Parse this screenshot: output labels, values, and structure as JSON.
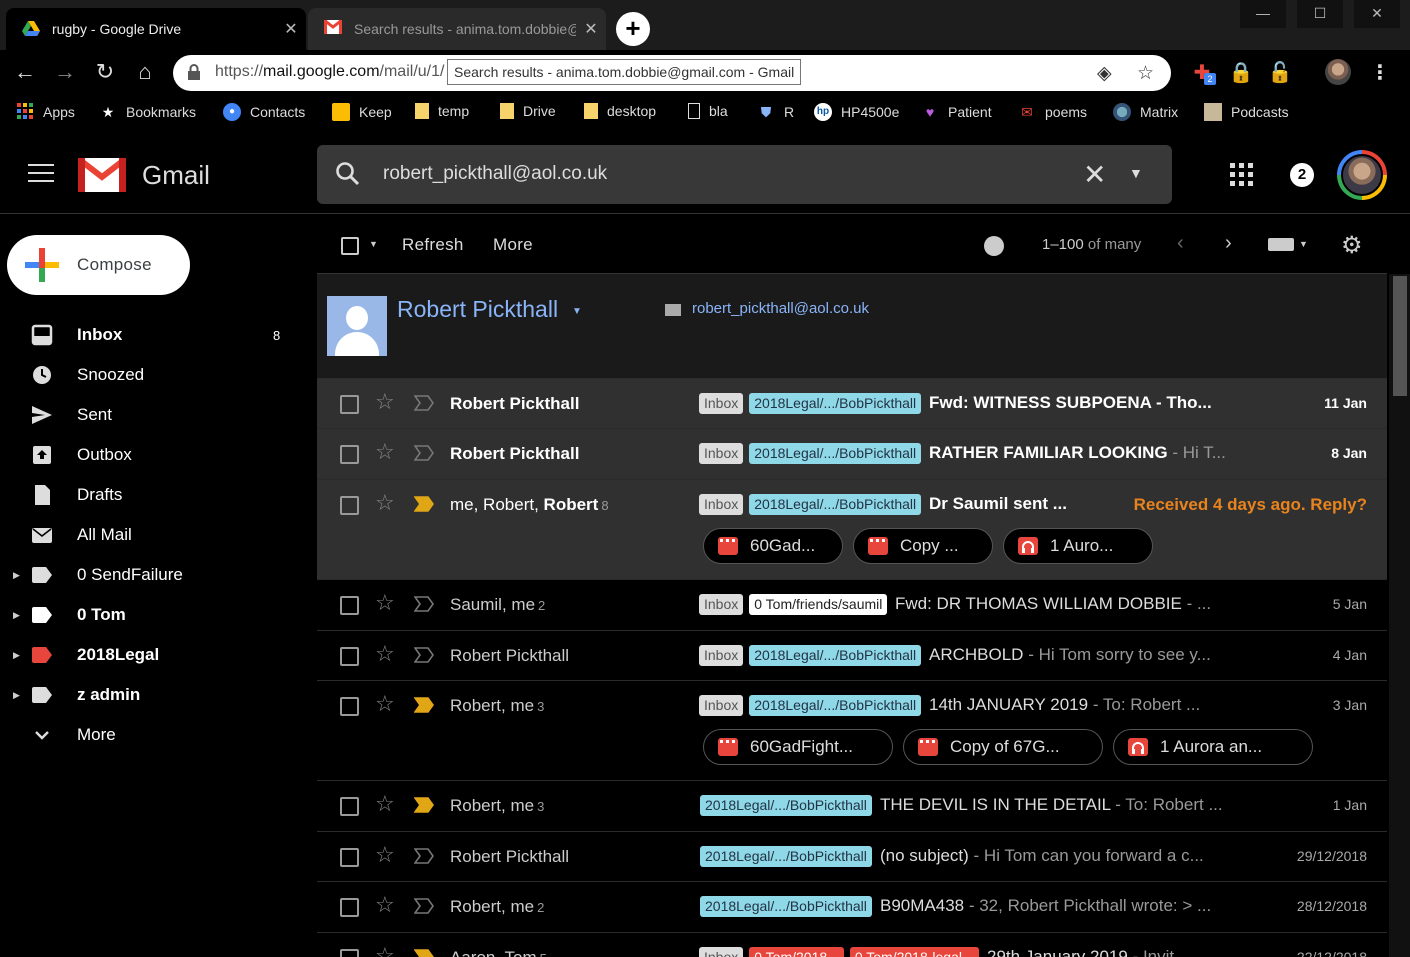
{
  "browser": {
    "tabs": [
      {
        "title": "rugby - Google Drive",
        "active": true
      },
      {
        "title": "Search results - anima.tom.dobbie@gmail.com - Gmail",
        "active": false
      }
    ],
    "url_scheme": "https://",
    "url_host": "mail.google.com",
    "url_path": "/mail/u/1/",
    "tooltip": "Search results - anima.tom.dobbie@gmail.com - Gmail",
    "extension_badge": "2",
    "bookmarks": [
      {
        "label": "Apps",
        "icon": "apps-icon"
      },
      {
        "label": "Bookmarks",
        "icon": "star-icon"
      },
      {
        "label": "Contacts",
        "icon": "contacts-icon"
      },
      {
        "label": "Keep",
        "icon": "keep-icon"
      },
      {
        "label": "temp",
        "icon": "folder-icon"
      },
      {
        "label": "Drive",
        "icon": "folder-icon"
      },
      {
        "label": "desktop",
        "icon": "folder-icon"
      },
      {
        "label": "bla",
        "icon": "page-icon"
      },
      {
        "label": "R",
        "icon": "shield-icon"
      },
      {
        "label": "HP4500e",
        "icon": "hp-icon"
      },
      {
        "label": "Patient",
        "icon": "heart-icon"
      },
      {
        "label": "poems",
        "icon": "gmail-icon"
      },
      {
        "label": "Matrix",
        "icon": "globe-icon"
      },
      {
        "label": "Podcasts",
        "icon": "podcast-icon"
      }
    ]
  },
  "gmail": {
    "brand": "Gmail",
    "search_query": "robert_pickthall@aol.co.uk",
    "notifications": "2",
    "compose_label": "Compose",
    "nav": [
      {
        "label": "Inbox",
        "count": "8",
        "icon": "inbox-icon",
        "bold": true,
        "arrow": false
      },
      {
        "label": "Snoozed",
        "count": "",
        "icon": "clock-icon",
        "bold": false,
        "arrow": false
      },
      {
        "label": "Sent",
        "count": "",
        "icon": "send-icon",
        "bold": false,
        "arrow": false
      },
      {
        "label": "Outbox",
        "count": "",
        "icon": "outbox-icon",
        "bold": false,
        "arrow": false
      },
      {
        "label": "Drafts",
        "count": "",
        "icon": "draft-icon",
        "bold": false,
        "arrow": false
      },
      {
        "label": "All Mail",
        "count": "",
        "icon": "mail-icon",
        "bold": false,
        "arrow": false
      },
      {
        "label": "0 SendFailure",
        "count": "",
        "icon": "label-icon",
        "bold": false,
        "arrow": true,
        "color": "#dddddd"
      },
      {
        "label": "0 Tom",
        "count": "",
        "icon": "label-icon",
        "bold": true,
        "arrow": true,
        "color": "#ffffff"
      },
      {
        "label": "2018Legal",
        "count": "",
        "icon": "label-icon",
        "bold": true,
        "arrow": true,
        "color": "#e8453c"
      },
      {
        "label": "z admin",
        "count": "",
        "icon": "label-icon",
        "bold": true,
        "arrow": true,
        "color": "#dddddd"
      },
      {
        "label": "More",
        "count": "",
        "icon": "chevron-down-icon",
        "bold": false,
        "arrow": false
      }
    ],
    "toolbar": {
      "refresh": "Refresh",
      "more": "More",
      "range": "1–100",
      "range_suffix": "of many"
    },
    "contact": {
      "name": "Robert Pickthall",
      "email": "robert_pickthall@aol.co.uk"
    },
    "messages": [
      {
        "sender": "Robert Pickthall",
        "sender_bold": "Robert Pickthall",
        "count": "",
        "unread": true,
        "important": false,
        "labels": [
          {
            "text": "Inbox",
            "kind": "inbox"
          },
          {
            "text": "2018Legal/.../BobPickthall",
            "kind": "legal"
          }
        ],
        "subject": "Fwd: WITNESS SUBPOENA - Tho...",
        "snippet": "",
        "date": "11 Jan",
        "nudge": "",
        "attachments": []
      },
      {
        "sender": "Robert Pickthall",
        "sender_bold": "Robert Pickthall",
        "count": "",
        "unread": true,
        "important": false,
        "labels": [
          {
            "text": "Inbox",
            "kind": "inbox"
          },
          {
            "text": "2018Legal/.../BobPickthall",
            "kind": "legal"
          }
        ],
        "subject": "RATHER FAMILIAR LOOKING",
        "snippet": " - Hi T...",
        "date": "8 Jan",
        "nudge": "",
        "attachments": []
      },
      {
        "sender": "me, Robert, ",
        "sender_bold": "Robert",
        "count": "8",
        "unread": true,
        "important": true,
        "labels": [
          {
            "text": "Inbox",
            "kind": "inbox"
          },
          {
            "text": "2018Legal/.../BobPickthall",
            "kind": "legal"
          }
        ],
        "subject": "Dr Saumil sent ...",
        "snippet": "",
        "date": "",
        "nudge": "Received 4 days ago. Reply?",
        "attachments": [
          {
            "name": "60Gad...",
            "kind": "video"
          },
          {
            "name": "Copy ...",
            "kind": "video"
          },
          {
            "name": "1 Auro...",
            "kind": "audio"
          }
        ]
      },
      {
        "sender": "Saumil, me",
        "sender_bold": "",
        "count": "2",
        "unread": false,
        "important": false,
        "labels": [
          {
            "text": "Inbox",
            "kind": "inbox"
          },
          {
            "text": "0 Tom/friends/saumil",
            "kind": "tom"
          }
        ],
        "subject": "Fwd: DR THOMAS WILLIAM DOBBIE",
        "snippet": " - ...",
        "date": "5 Jan",
        "nudge": "",
        "attachments": []
      },
      {
        "sender": "Robert Pickthall",
        "sender_bold": "",
        "count": "",
        "unread": false,
        "important": false,
        "labels": [
          {
            "text": "Inbox",
            "kind": "inbox"
          },
          {
            "text": "2018Legal/.../BobPickthall",
            "kind": "legal"
          }
        ],
        "subject": "ARCHBOLD",
        "snippet": " - Hi Tom sorry to see y...",
        "date": "4 Jan",
        "nudge": "",
        "attachments": []
      },
      {
        "sender": "Robert, me",
        "sender_bold": "",
        "count": "3",
        "unread": false,
        "important": true,
        "labels": [
          {
            "text": "Inbox",
            "kind": "inbox"
          },
          {
            "text": "2018Legal/.../BobPickthall",
            "kind": "legal"
          }
        ],
        "subject": "14th JANUARY 2019",
        "snippet": " - To: Robert ...",
        "date": "3 Jan",
        "nudge": "",
        "attachments": [
          {
            "name": "60GadFight...",
            "kind": "video"
          },
          {
            "name": "Copy of 67G...",
            "kind": "video"
          },
          {
            "name": "1 Aurora an...",
            "kind": "audio"
          }
        ]
      },
      {
        "sender": "Robert, me",
        "sender_bold": "",
        "count": "3",
        "unread": false,
        "important": true,
        "labels": [
          {
            "text": "2018Legal/.../BobPickthall",
            "kind": "legal"
          }
        ],
        "subject": "THE DEVIL IS IN THE DETAIL",
        "snippet": " - To: Robert ...",
        "date": "1 Jan",
        "nudge": "",
        "attachments": []
      },
      {
        "sender": "Robert Pickthall",
        "sender_bold": "",
        "count": "",
        "unread": false,
        "important": false,
        "labels": [
          {
            "text": "2018Legal/.../BobPickthall",
            "kind": "legal"
          }
        ],
        "subject": "(no subject)",
        "snippet": " - Hi Tom can you forward a c...",
        "date": "29/12/2018",
        "nudge": "",
        "attachments": []
      },
      {
        "sender": "Robert, me",
        "sender_bold": "",
        "count": "2",
        "unread": false,
        "important": false,
        "labels": [
          {
            "text": "2018Legal/.../BobPickthall",
            "kind": "legal"
          }
        ],
        "subject": "B90MA438",
        "snippet": " - 32, Robert Pickthall wrote: > ...",
        "date": "28/12/2018",
        "nudge": "",
        "attachments": []
      },
      {
        "sender": "Aaron, Tom",
        "sender_bold": "",
        "count": "5",
        "unread": false,
        "important": true,
        "labels": [
          {
            "text": "Inbox",
            "kind": "inbox"
          },
          {
            "text": "0 Tom/2018...",
            "kind": "red"
          },
          {
            "text": "0 Tom/2018-legal...",
            "kind": "red"
          }
        ],
        "subject": "29th January 2019",
        "snippet": " - Invit...",
        "date": "22/12/2018",
        "nudge": "",
        "attachments": []
      }
    ]
  }
}
